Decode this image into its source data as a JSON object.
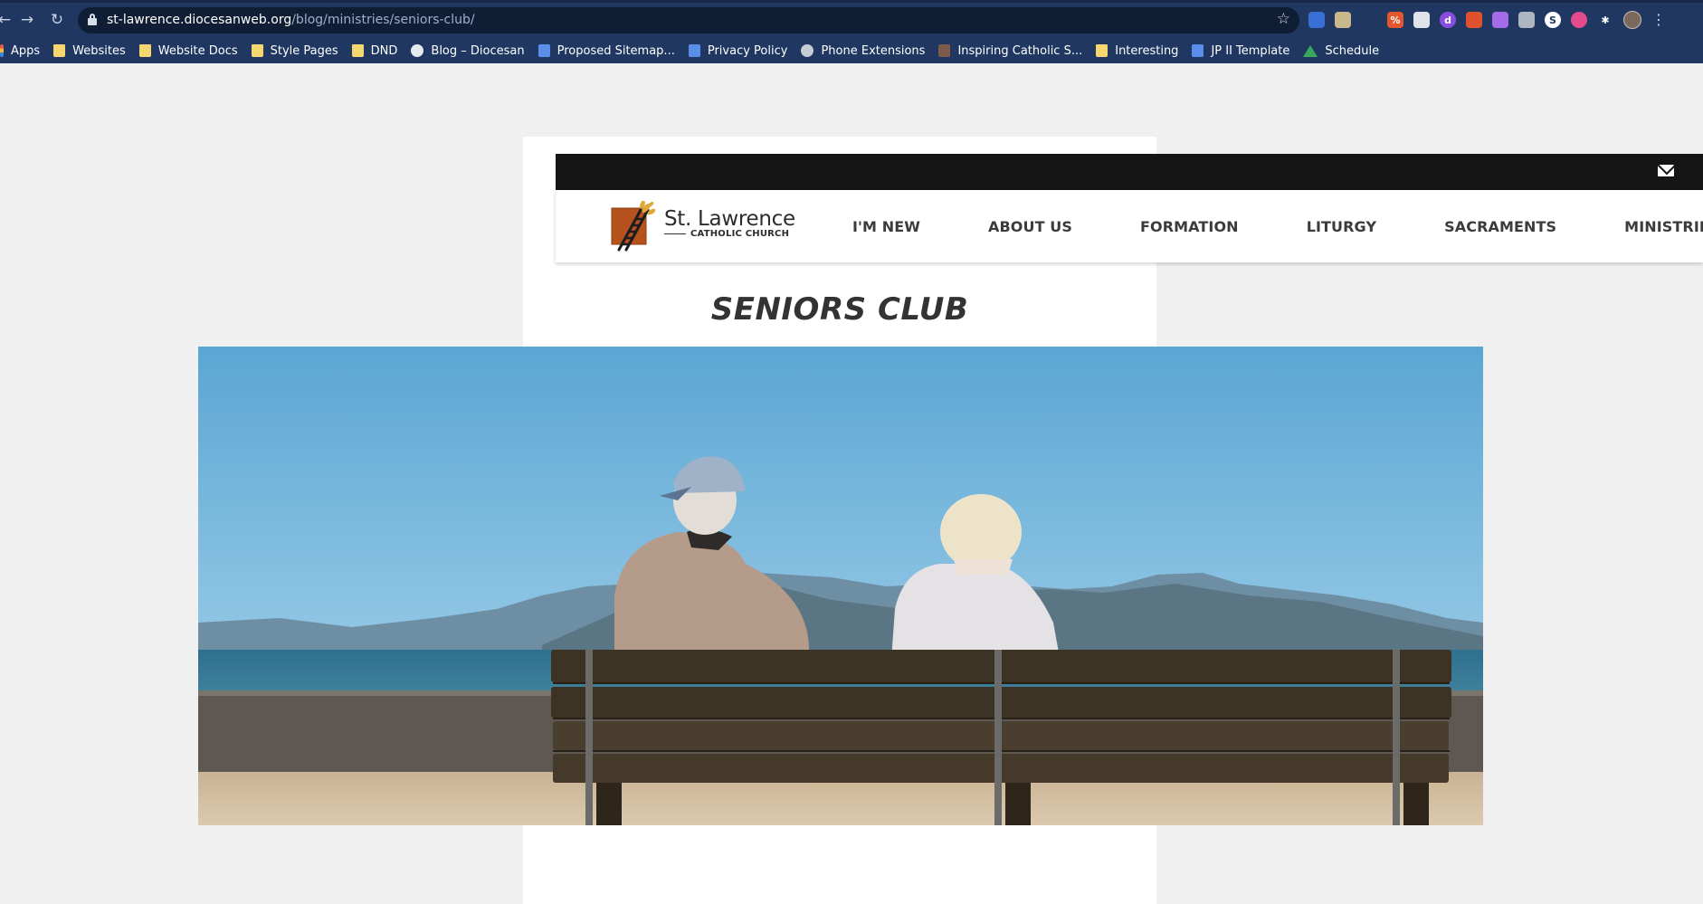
{
  "browser": {
    "back_glyph": "←",
    "forward_glyph": "→",
    "reload_glyph": "↻",
    "url_host": "st-lawrence.diocesanweb.org",
    "url_path": "/blog/ministries/seniors-club/",
    "star_glyph": "☆",
    "menu_glyph": "⋮",
    "extensions": [
      {
        "icon": "calendar-badge-icon",
        "color": "#3b6fd8",
        "label": ""
      },
      {
        "icon": "image-icon",
        "color": "#c9b98a",
        "label": ""
      },
      {
        "icon": "crop-icon",
        "color": "#1f3761",
        "label": ""
      },
      {
        "icon": "percent-icon",
        "color": "#e4572e",
        "label": "%"
      },
      {
        "icon": "document-icon",
        "color": "#dfe3ea",
        "label": ""
      },
      {
        "icon": "purple-circle-icon",
        "color": "#8a4de0",
        "label": "d"
      },
      {
        "icon": "multi-app-icon",
        "color": "#e0522d",
        "label": ""
      },
      {
        "icon": "feather-icon",
        "color": "#a66be8",
        "label": ""
      },
      {
        "icon": "gray-square-icon",
        "color": "#aeb6c2",
        "label": ""
      },
      {
        "icon": "s-circle-icon",
        "color": "#ffffff",
        "label": "S"
      },
      {
        "icon": "color-ring-icon",
        "color": "#e44b8d",
        "label": ""
      },
      {
        "icon": "puzzle-icon",
        "color": "#1f3761",
        "label": "✱"
      }
    ]
  },
  "bookmarks": [
    {
      "label": "Apps",
      "icon": "apps"
    },
    {
      "label": "Websites",
      "icon": "folder"
    },
    {
      "label": "Website Docs",
      "icon": "folder"
    },
    {
      "label": "Style Pages",
      "icon": "folder"
    },
    {
      "label": "DND",
      "icon": "folder"
    },
    {
      "label": "Blog – Diocesan",
      "icon": "globe"
    },
    {
      "label": "Proposed Sitemap...",
      "icon": "doc"
    },
    {
      "label": "Privacy Policy",
      "icon": "doc"
    },
    {
      "label": "Phone Extensions",
      "icon": "web"
    },
    {
      "label": "Inspiring Catholic S...",
      "icon": "img"
    },
    {
      "label": "Interesting",
      "icon": "folder"
    },
    {
      "label": "JP II Template",
      "icon": "doc"
    },
    {
      "label": "Schedule",
      "icon": "drive"
    }
  ],
  "site": {
    "logo_name": "St. Lawrence",
    "logo_sub": "CATHOLIC CHURCH",
    "nav": [
      "I'M NEW",
      "ABOUT US",
      "FORMATION",
      "LITURGY",
      "SACRAMENTS",
      "MINISTRIES/SERVI"
    ],
    "page_title": "SENIORS CLUB"
  }
}
